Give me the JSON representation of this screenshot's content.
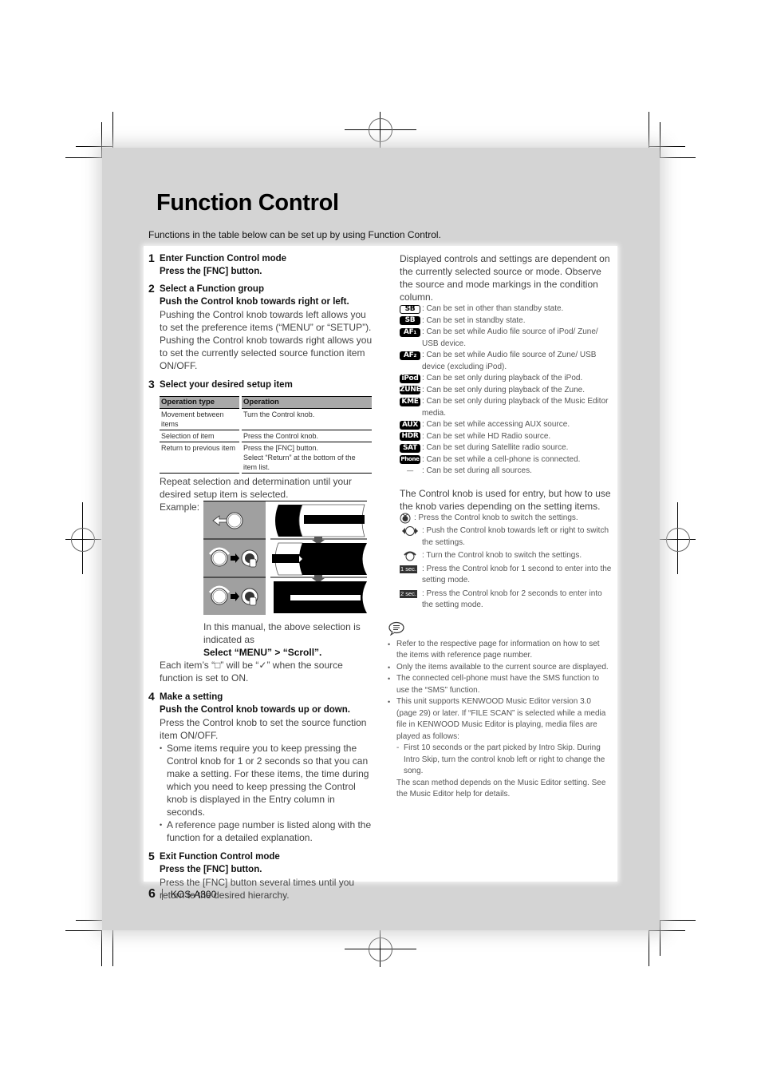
{
  "page": {
    "title": "Function Control",
    "intro": "Functions in the table below can be set up by using Function Control.",
    "footer": {
      "page_number": "6",
      "model": "KOS-A300"
    }
  },
  "steps": [
    {
      "num": "1",
      "title": "Enter Function Control mode",
      "sub": "Press the [FNC] button.",
      "body": ""
    },
    {
      "num": "2",
      "title": "Select a Function group",
      "sub": "Push the Control knob towards right or left.",
      "body": "Pushing the Control knob towards left allows you to set the preference items (“MENU” or “SETUP”). Pushing the Control knob towards right allows you to set the currently selected source function item ON/OFF."
    },
    {
      "num": "3",
      "title": "Select your desired setup item",
      "sub": "",
      "body": ""
    },
    {
      "num": "4",
      "title": "Make a setting",
      "sub": "Push the Control knob towards up or down.",
      "body": "Press the Control knob to set the source function item ON/OFF."
    },
    {
      "num": "5",
      "title": "Exit Function Control mode",
      "sub": "Press the [FNC] button.",
      "body": "Press the [FNC] button several times until you return to the desired hierarchy."
    }
  ],
  "ops_table": {
    "headers": [
      "Operation type",
      "Operation"
    ],
    "rows": [
      [
        "Movement between items",
        "Turn the Control knob.",
        ""
      ],
      [
        "Selection of item",
        "Press the Control knob.",
        ""
      ],
      [
        "Return to previous item",
        "Press the [FNC] button.",
        "Select “Return” at the bottom of the item list."
      ]
    ]
  },
  "step3_text": {
    "repeat": "Repeat selection and determination until your desired setup item is selected.",
    "example_label": "Example:",
    "manual_note": "In this manual, the above selection is indicated as",
    "select_path": "Select “MENU” > “Scroll”.",
    "checkmark_note": "Each item’s “□” will be “✓” when the source function is set to ON."
  },
  "step4_bullets": [
    "Some items require you to keep pressing the Control knob for 1 or 2 seconds so that you can make a setting. For these items, the time during which you need to keep pressing the Control knob is displayed in the Entry column in seconds.",
    "A reference page number is listed  along with the function for a detailed explanation."
  ],
  "right": {
    "intro": "Displayed controls and settings are dependent on the currently selected source or mode. Observe the source and mode markings in the condition column.",
    "conditions": [
      {
        "badge": "SB",
        "style": "outline",
        "text": ": Can be set in other than standby state."
      },
      {
        "badge": "SB",
        "style": "filled",
        "text": ": Can be set in standby state."
      },
      {
        "badge": "AF₁",
        "style": "filled",
        "text": ": Can be set while Audio file source of iPod/ Zune/ USB device."
      },
      {
        "badge": "AF₂",
        "style": "filled",
        "text": ": Can be set while Audio file source of Zune/ USB device (excluding iPod)."
      },
      {
        "badge": "iPod",
        "style": "filled",
        "text": ": Can be set only during playback of the iPod."
      },
      {
        "badge": "ZUNE",
        "style": "filled",
        "text": ": Can be set only during playback of the Zune."
      },
      {
        "badge": "KME",
        "style": "filled",
        "text": ": Can be set only during playback of the Music Editor media."
      },
      {
        "badge": "AUX",
        "style": "filled",
        "text": ": Can be set while accessing AUX source."
      },
      {
        "badge": "HDR",
        "style": "filled",
        "text": ": Can be set while HD Radio source."
      },
      {
        "badge": "SAT",
        "style": "filled",
        "text": ": Can be set during Satellite radio source."
      },
      {
        "badge": "Phone",
        "style": "filled",
        "text": ": Can be set while a cell-phone is connected."
      },
      {
        "badge": "—",
        "style": "dash",
        "text": ": Can be set during all sources."
      }
    ],
    "knob_intro": "The Control knob is used for entry, but how to use the knob varies depending on the setting items.",
    "knob_ops": [
      {
        "icon": "knob-press-icon",
        "text": ": Press the Control knob to switch the settings."
      },
      {
        "icon": "knob-push-left-right-icon",
        "text": ": Push the Control knob towards left or right to switch the settings."
      },
      {
        "icon": "knob-turn-icon",
        "text": ": Turn the Control knob to switch the settings."
      },
      {
        "icon": "1-sec-badge",
        "badge": "1 sec.",
        "text": ": Press the Control knob for 1 second to enter into the setting mode."
      },
      {
        "icon": "2-sec-badge",
        "badge": "2 sec.",
        "text": ": Press the Control knob for 2 seconds to enter into the setting mode."
      }
    ],
    "notes": [
      "Refer to the respective page for information on how to set the items with reference page number.",
      "Only the items available to the current source are displayed.",
      "The connected cell-phone must have the SMS function to use the “SMS” function.",
      "This unit supports KENWOOD Music Editor version 3.0 (page 29) or later. If “FILE SCAN” is selected while a media file in KENWOOD Music Editor is playing, media files are played as follows:"
    ],
    "note_sub": "First 10 seconds or the part picked by Intro Skip. During Intro Skip, turn the control knob left or right to change the song.",
    "note_tail": "The scan method depends on the Music Editor setting. See the Music Editor help for details."
  }
}
